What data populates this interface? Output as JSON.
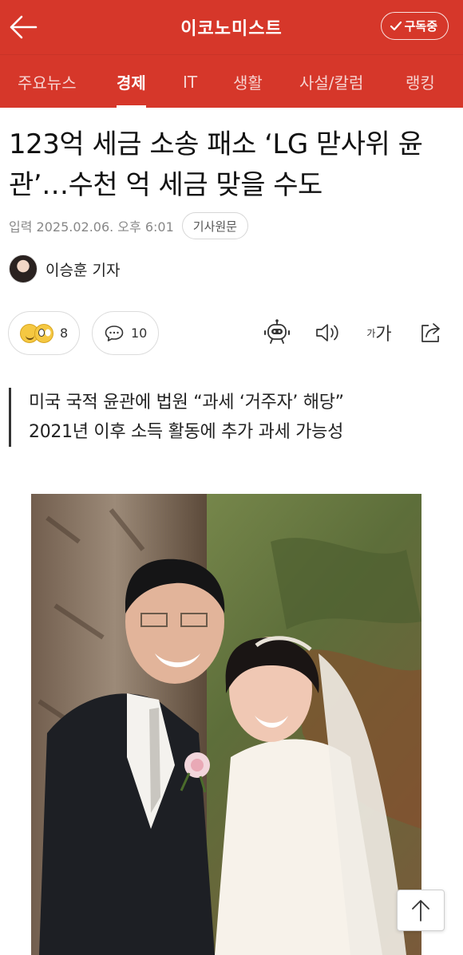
{
  "header": {
    "brand": "이코노미스트",
    "subscribe_label": "구독중"
  },
  "tabs": [
    {
      "label": "주요뉴스",
      "active": false
    },
    {
      "label": "경제",
      "active": true
    },
    {
      "label": "IT",
      "active": false
    },
    {
      "label": "생활",
      "active": false
    },
    {
      "label": "사설/칼럼",
      "active": false
    },
    {
      "label": "랭킹",
      "active": false
    }
  ],
  "article": {
    "headline": "123억 세금 소송 패소 ‘LG 맏사위 윤관’…수천 억 세금 맞을 수도",
    "date": "입력 2025.02.06. 오후 6:01",
    "original_label": "기사원문",
    "reporter": "이승훈 기자",
    "summary": [
      "미국 국적 윤관에 법원 “과세 ‘거주자’ 해당”",
      "2021년 이후 소득 활동에 추가 과세 가능성"
    ]
  },
  "actions": {
    "reactions_count": "8",
    "comments_count": "10",
    "font_small": "가",
    "font_large": "가"
  },
  "icons": {
    "back": "back-arrow-icon",
    "check": "check-icon",
    "comment": "comment-icon",
    "summary_bot": "robot-icon",
    "listen": "speaker-icon",
    "share": "share-icon",
    "scroll_top": "arrow-up-icon"
  },
  "colors": {
    "brand_red": "#d6372a",
    "text": "#111111",
    "muted": "#888888"
  }
}
